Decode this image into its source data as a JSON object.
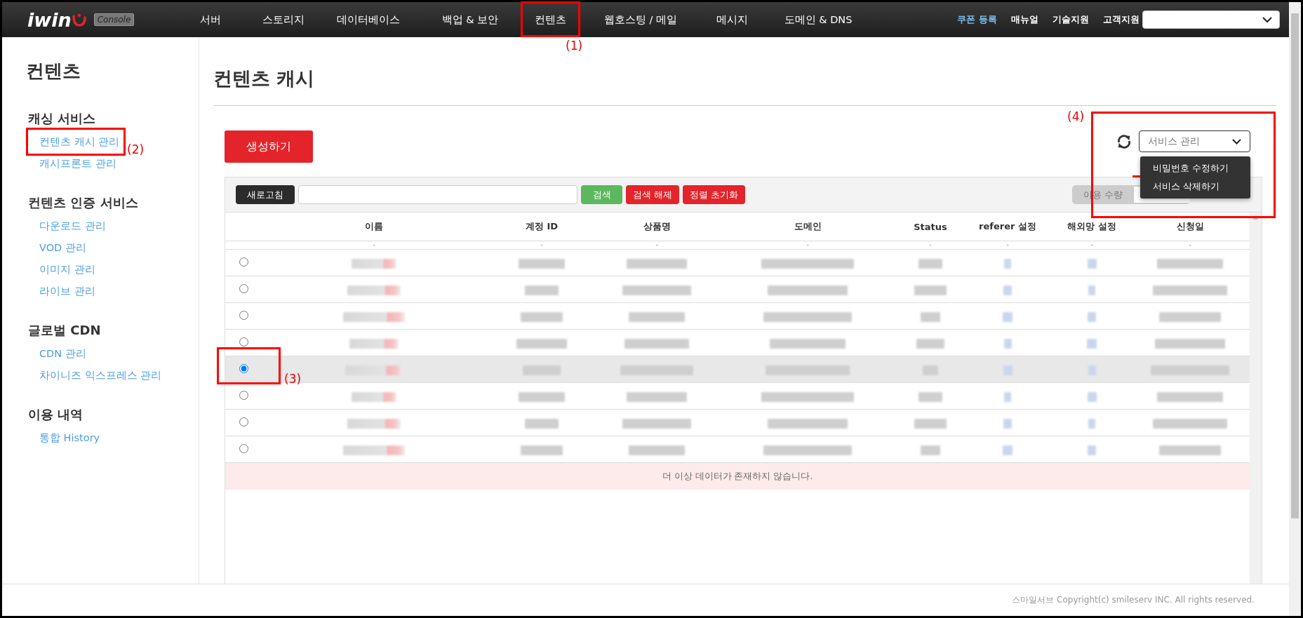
{
  "topbar": {
    "logo": "iwin",
    "badge": "Console",
    "nav": [
      {
        "label": "서버"
      },
      {
        "label": "스토리지"
      },
      {
        "label": "데이터베이스"
      },
      {
        "label": "백업 & 보안"
      },
      {
        "label": "컨텐츠"
      },
      {
        "label": "웹호스팅 / 메일"
      },
      {
        "label": "메시지"
      },
      {
        "label": "도메인 & DNS"
      }
    ],
    "links": [
      {
        "label": "쿠폰 등록",
        "highlight": true
      },
      {
        "label": "매뉴얼",
        "highlight": false
      },
      {
        "label": "기술지원",
        "highlight": false
      },
      {
        "label": "고객지원",
        "highlight": false
      }
    ]
  },
  "sidebar": {
    "title": "컨텐츠",
    "sections": [
      {
        "title": "캐싱 서비스",
        "items": [
          "컨텐츠 캐시 관리",
          "캐시프론트 관리"
        ]
      },
      {
        "title": "컨텐츠 인증 서비스",
        "items": [
          "다운로드 관리",
          "VOD 관리",
          "이미지 관리",
          "라이브 관리"
        ]
      },
      {
        "title": "글로벌 CDN",
        "items": [
          "CDN 관리",
          "차이니즈 익스프레스 관리"
        ]
      },
      {
        "title": "이용 내역",
        "items": [
          "통합 History"
        ]
      }
    ]
  },
  "page": {
    "title": "컨텐츠 캐시",
    "create_button": "생성하기",
    "service_select": {
      "value": "서비스 관리",
      "expanded": true,
      "options": [
        "비밀번호 수정하기",
        "서비스 삭제하기"
      ]
    }
  },
  "toolbar": {
    "refresh_button": "새로고침",
    "search_button": "검색",
    "clear_button": "검색 해제",
    "reset_sort_button": "정렬 초기화",
    "usage_toggle": "이용 수량"
  },
  "table": {
    "columns": [
      "이름",
      "계정 ID",
      "상품명",
      "도메인",
      "Status",
      "referer 설정",
      "해외망 설정",
      "신청일"
    ],
    "filter_row": [
      "-",
      "-",
      "-",
      "-",
      "-",
      "-",
      "-",
      "-"
    ],
    "rows": [
      {
        "selected": false
      },
      {
        "selected": false
      },
      {
        "selected": false
      },
      {
        "selected": false
      },
      {
        "selected": true
      },
      {
        "selected": false
      },
      {
        "selected": false
      },
      {
        "selected": false
      }
    ],
    "empty_message": "더 이상 데이터가 존재하지 않습니다."
  },
  "annotations": [
    {
      "label": "(1)"
    },
    {
      "label": "(2)"
    },
    {
      "label": "(3)"
    },
    {
      "label": "(4)"
    }
  ],
  "footer": "스마일서브 Copyright(c) smileserv INC. All rights reserved."
}
